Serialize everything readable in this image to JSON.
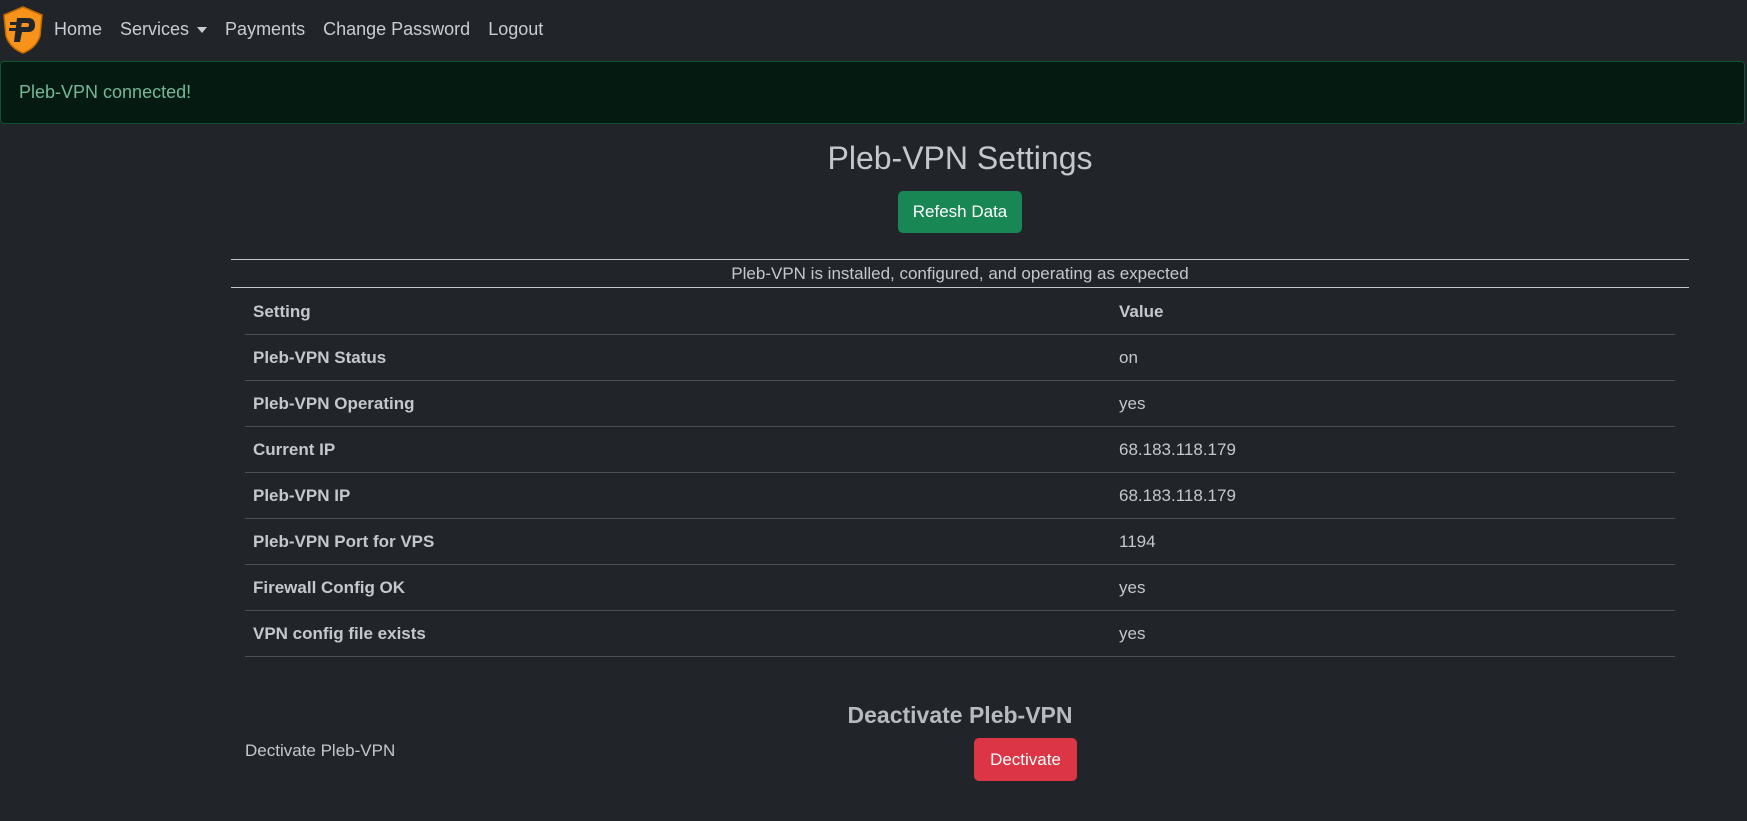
{
  "navbar": {
    "logo_icon": "pleb-vpn-logo-icon",
    "brand_color": "#f7931a",
    "items": [
      {
        "label": "Home"
      },
      {
        "label": "Services",
        "dropdown": true
      },
      {
        "label": "Payments"
      },
      {
        "label": "Change Password"
      },
      {
        "label": "Logout"
      }
    ]
  },
  "alert": {
    "message": "Pleb-VPN connected!",
    "color": "#75b798"
  },
  "main": {
    "title": "Pleb-VPN Settings",
    "refresh_button": "Refesh Data",
    "status_caption": "Pleb-VPN is installed, configured, and operating as expected",
    "table": {
      "headers": [
        "Setting",
        "Value"
      ],
      "rows": [
        {
          "setting": "Pleb-VPN Status",
          "value": "on"
        },
        {
          "setting": "Pleb-VPN Operating",
          "value": "yes"
        },
        {
          "setting": "Current IP",
          "value": "68.183.118.179"
        },
        {
          "setting": "Pleb-VPN IP",
          "value": "68.183.118.179"
        },
        {
          "setting": "Pleb-VPN Port for VPS",
          "value": "1194"
        },
        {
          "setting": "Firewall Config OK",
          "value": "yes"
        },
        {
          "setting": "VPN config file exists",
          "value": "yes"
        }
      ]
    }
  },
  "deactivate": {
    "title": "Deactivate Pleb-VPN",
    "label": "Dectivate Pleb-VPN",
    "button": "Dectivate"
  },
  "colors": {
    "background": "#212529",
    "success": "#198754",
    "danger": "#dc3545"
  }
}
